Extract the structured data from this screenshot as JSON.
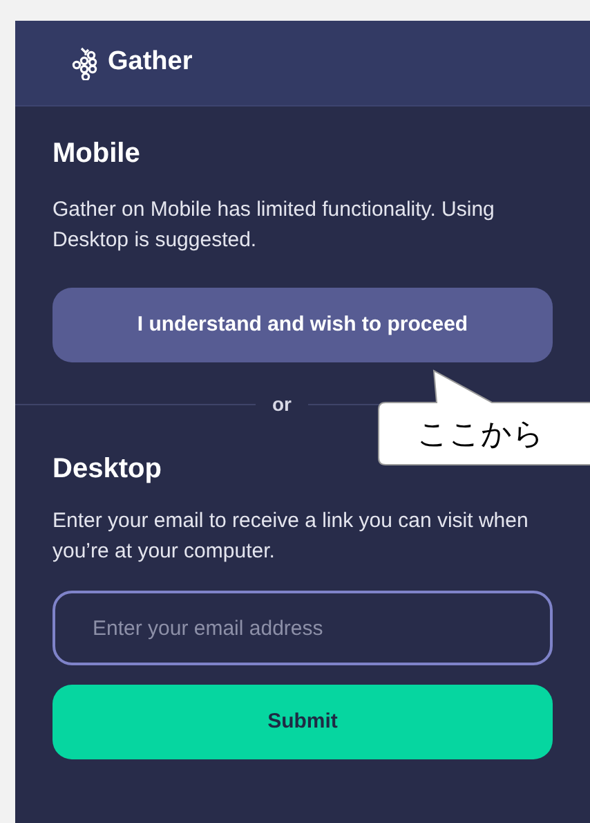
{
  "header": {
    "logo_text": "Gather"
  },
  "mobile": {
    "title": "Mobile",
    "description": "Gather on Mobile has limited functionality. Using Desktop is suggested.",
    "button": "I understand and wish to proceed"
  },
  "divider": {
    "label": "or"
  },
  "desktop": {
    "title": "Desktop",
    "description": "Enter your email to receive a link you can visit when you’re at your computer.",
    "email_field": {
      "placeholder": "Enter your email address"
    },
    "button": "Submit"
  },
  "callout": {
    "text": "ここから"
  }
}
